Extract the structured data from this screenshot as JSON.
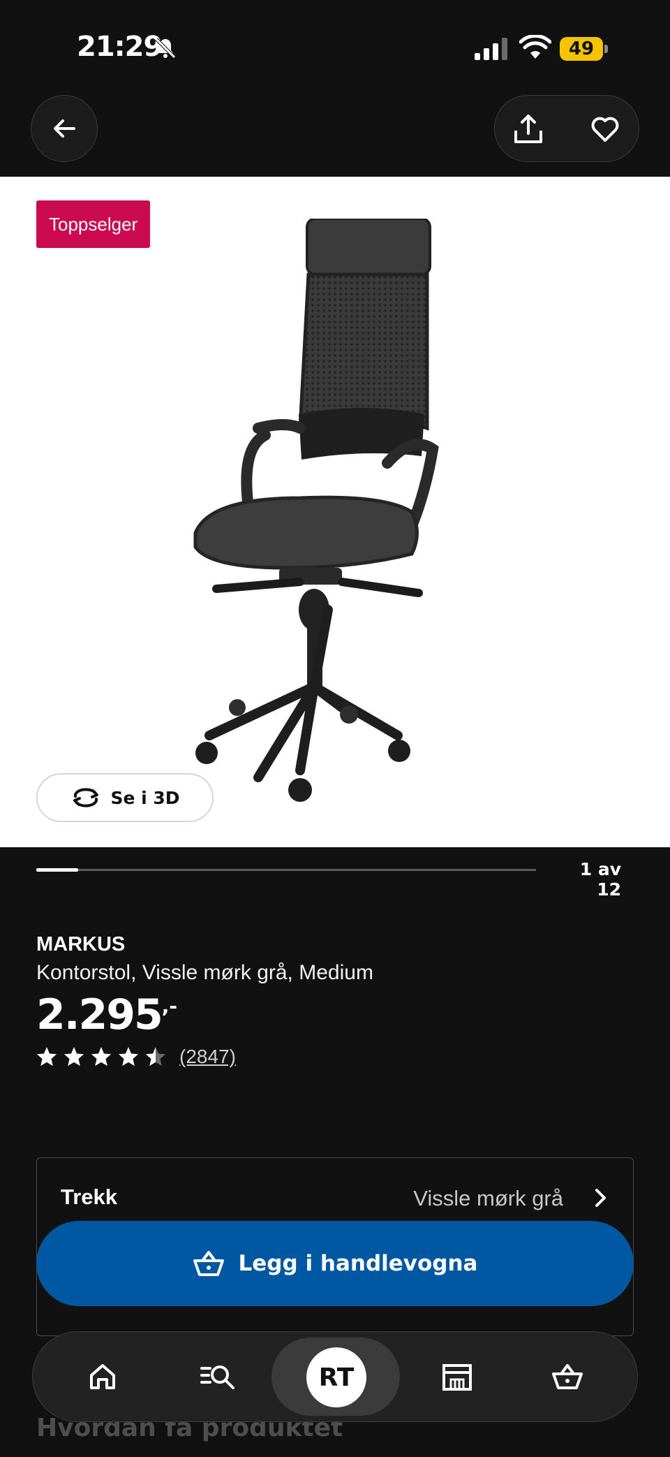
{
  "status_bar": {
    "time": "21:29",
    "battery": "49",
    "icons": [
      "bell-slash-icon",
      "signal-icon",
      "wifi-icon",
      "battery-icon"
    ]
  },
  "header": {
    "icons": [
      "arrow-left-icon",
      "share-icon",
      "heart-icon"
    ]
  },
  "image": {
    "badge": "Toppselger",
    "view_3d_label": "Se i 3D",
    "carousel_counter": "1 av 12",
    "carousel_current": 1,
    "carousel_total": 12
  },
  "product": {
    "name": "MARKUS",
    "description": "Kontorstol, Vissle mørk grå, Medium",
    "price": "2.295",
    "price_suffix": ",-",
    "rating": 4.5,
    "rating_max": 5,
    "review_count": "(2847)"
  },
  "option": {
    "label": "Trekk",
    "value": "Vissle mørk grå"
  },
  "cta": {
    "add_to_cart": "Legg i handlevogna"
  },
  "section": {
    "heading": "Hvordan få produktet"
  },
  "bottom_nav": {
    "avatar_initials": "RT",
    "icons": [
      "home-icon",
      "search-list-icon",
      "store-icon",
      "cart-icon"
    ]
  },
  "colors": {
    "background": "#111111",
    "badge": "#cc0a4f",
    "cta": "#0058a3",
    "battery": "#f5c400"
  }
}
